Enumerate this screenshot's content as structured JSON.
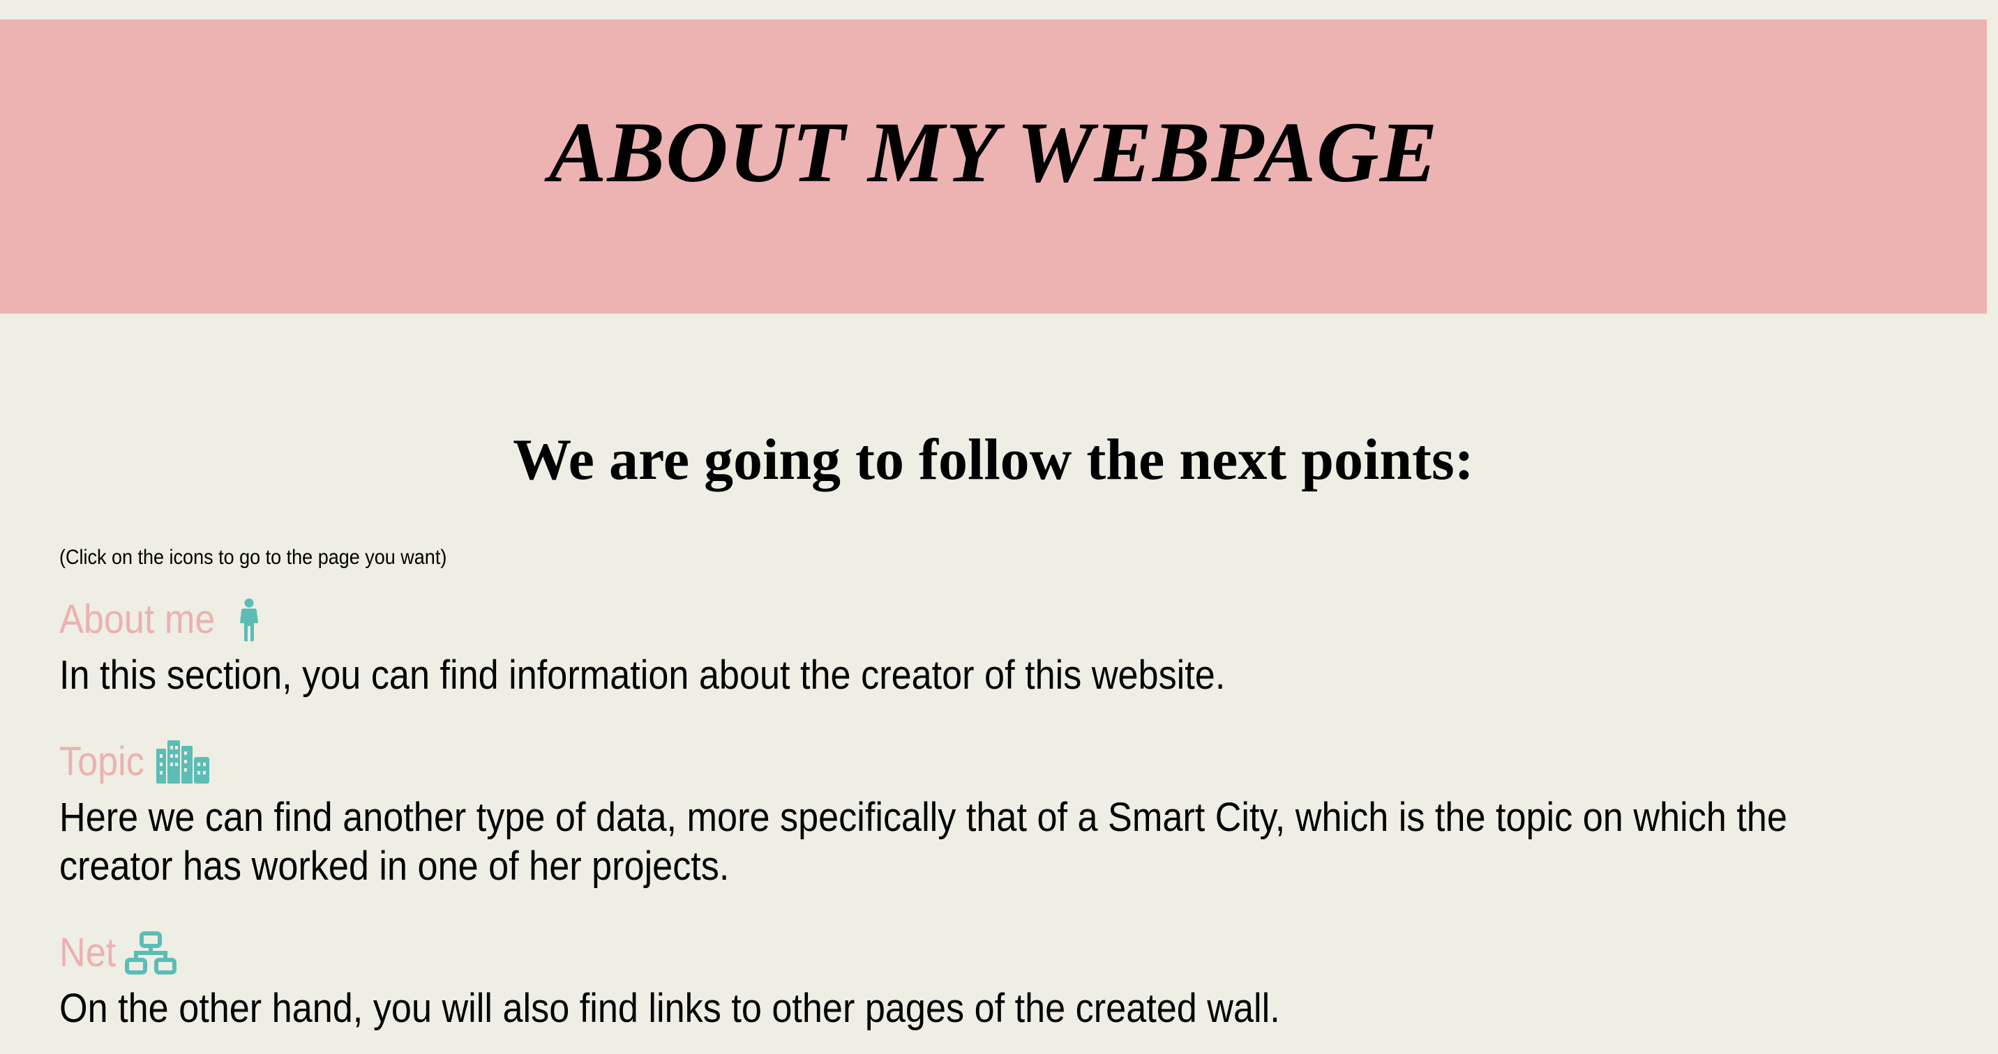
{
  "header": {
    "title": "ABOUT MY WEBPAGE"
  },
  "main": {
    "heading": "We are going to follow the next points:",
    "hint": "(Click on the icons to go to the page you want)",
    "items": [
      {
        "label": "About me",
        "icon": "person-icon",
        "description": "In this section, you can find information about the creator of this website."
      },
      {
        "label": "Topic",
        "icon": "city-icon",
        "description": "Here we can find another type of data, more specifically that of a Smart City, which is the topic on which the creator has worked in one of her projects."
      },
      {
        "label": "Net",
        "icon": "network-icon",
        "description": "On the other hand, you will also find links to other pages of the created wall."
      }
    ]
  },
  "colors": {
    "background": "#eeeee4",
    "banner": "#ecb3b2",
    "link_text": "#ebb1b0",
    "icon": "#5bbdb6"
  }
}
